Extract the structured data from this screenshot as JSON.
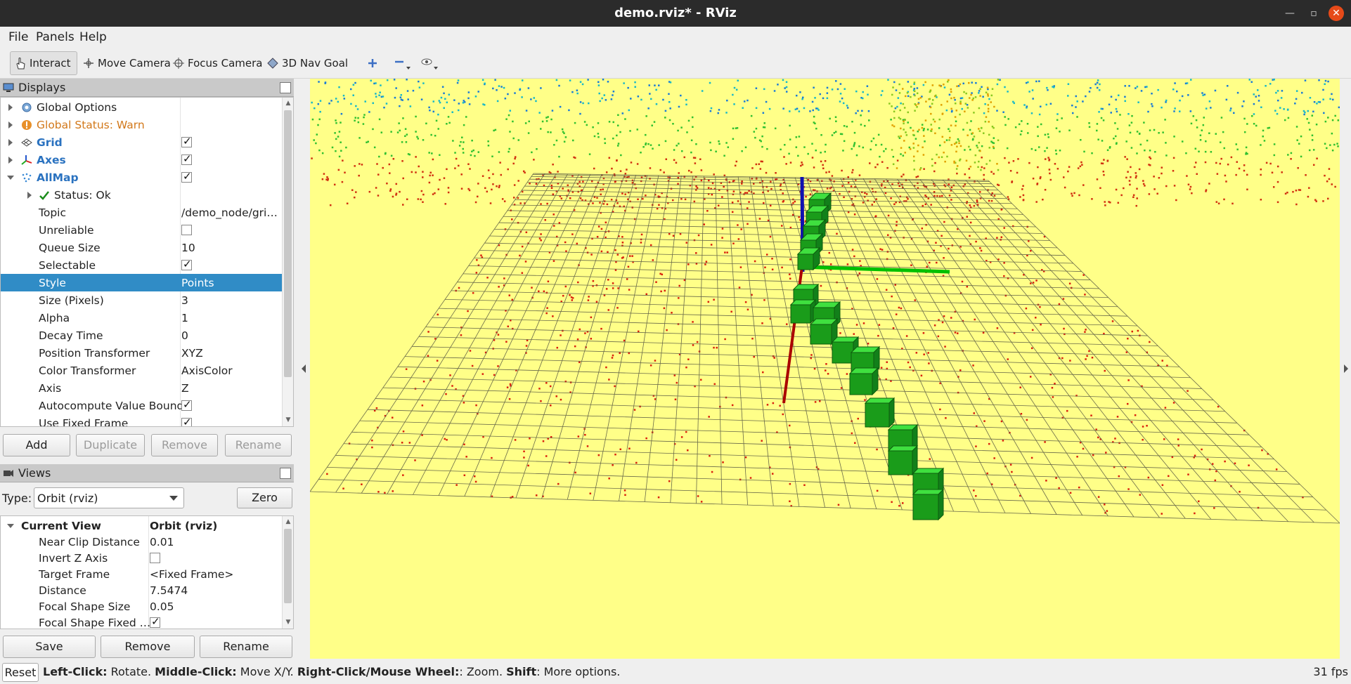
{
  "window": {
    "title": "demo.rviz* - RViz",
    "minimize_icon": "minimize-icon",
    "maximize_icon": "maximize-icon",
    "close_icon": "close-icon"
  },
  "menu": [
    "File",
    "Panels",
    "Help"
  ],
  "toolbar": {
    "interact": "Interact",
    "move_camera": "Move Camera",
    "focus_camera": "Focus Camera",
    "nav_goal": "3D Nav Goal",
    "add_icon": "plus-icon",
    "remove_icon": "minus-icon",
    "view_icon": "eye-icon"
  },
  "displays": {
    "title": "Displays",
    "rows": [
      {
        "label": "Global Options",
        "value": ""
      },
      {
        "label": "Global Status: Warn",
        "value": ""
      },
      {
        "label": "Grid",
        "value": ""
      },
      {
        "label": "Axes",
        "value": ""
      },
      {
        "label": "AllMap",
        "value": ""
      },
      {
        "label": "Status: Ok",
        "value": ""
      },
      {
        "label": "Topic",
        "value": "/demo_node/grid…"
      },
      {
        "label": "Unreliable",
        "value": ""
      },
      {
        "label": "Queue Size",
        "value": "10"
      },
      {
        "label": "Selectable",
        "value": ""
      },
      {
        "label": "Style",
        "value": "Points"
      },
      {
        "label": "Size (Pixels)",
        "value": "3"
      },
      {
        "label": "Alpha",
        "value": "1"
      },
      {
        "label": "Decay Time",
        "value": "0"
      },
      {
        "label": "Position Transformer",
        "value": "XYZ"
      },
      {
        "label": "Color Transformer",
        "value": "AxisColor"
      },
      {
        "label": "Axis",
        "value": "Z"
      },
      {
        "label": "Autocompute Value Bounds",
        "value": ""
      },
      {
        "label": "Use Fixed Frame",
        "value": ""
      }
    ],
    "buttons": {
      "add": "Add",
      "duplicate": "Duplicate",
      "remove": "Remove",
      "rename": "Rename"
    }
  },
  "views": {
    "title": "Views",
    "type_label": "Type:",
    "type_value": "Orbit (rviz)",
    "zero": "Zero",
    "rows": [
      {
        "label": "Current View",
        "value": "Orbit (rviz)"
      },
      {
        "label": "Near Clip Distance",
        "value": "0.01"
      },
      {
        "label": "Invert Z Axis",
        "value": ""
      },
      {
        "label": "Target Frame",
        "value": "<Fixed Frame>"
      },
      {
        "label": "Distance",
        "value": "7.5474"
      },
      {
        "label": "Focal Shape Size",
        "value": "0.05"
      },
      {
        "label": "Focal Shape Fixed …",
        "value": ""
      }
    ],
    "buttons": {
      "save": "Save",
      "remove": "Remove",
      "rename": "Rename"
    }
  },
  "statusbar": {
    "reset": "Reset",
    "help_bold_1": "Left-Click:",
    "help_text_1": " Rotate. ",
    "help_bold_2": "Middle-Click:",
    "help_text_2": " Move X/Y. ",
    "help_bold_3": "Right-Click/Mouse Wheel:",
    "help_text_3": ": Zoom. ",
    "help_bold_4": "Shift",
    "help_text_4": ": More options.",
    "fps": "31 fps"
  },
  "colors": {
    "viewport_bg": "#ffff88",
    "selection": "#308cc6",
    "warn": "#d2781a",
    "display_name": "#2a72c0",
    "cube": "#22cc22"
  }
}
